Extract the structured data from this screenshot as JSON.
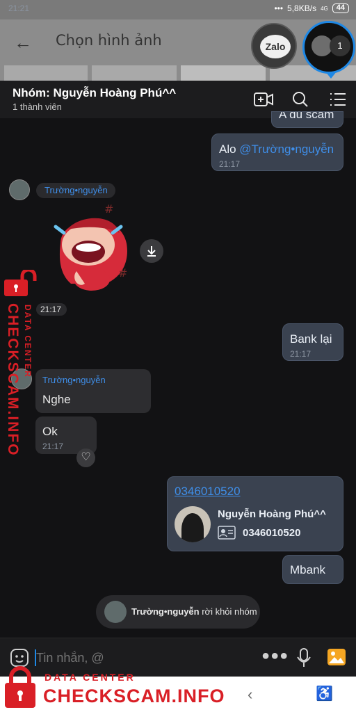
{
  "status_bar": {
    "time": "21:21",
    "speed": "5,8KB/s",
    "network": "4G",
    "battery": "44"
  },
  "picker": {
    "back_icon": "arrow-left-icon",
    "title": "Chọn hình ảnh"
  },
  "floating": {
    "zalo_label": "Zalo",
    "chat_badge": "1"
  },
  "header": {
    "title": "Nhóm: Nguyễn Hoàng Phú^^",
    "subtitle": "1 thành viên",
    "icons": [
      "video-call-icon",
      "search-icon",
      "menu-list-icon"
    ]
  },
  "messages": {
    "partial_top": "A đủ scam",
    "alo": {
      "text": "Alo ",
      "mention": "@Trường•nguyễn",
      "time": "21:17"
    },
    "sender1": "Trường•nguyễn",
    "sticker_time": "21:17",
    "bank": {
      "text": "Bank lại",
      "time": "21:17"
    },
    "sender2": "Trường•nguyễn",
    "nghe": "Nghe",
    "ok": {
      "text": "Ok",
      "time": "21:17"
    },
    "contact": {
      "number_link": "0346010520",
      "name": "Nguyễn Hoàng Phú^^",
      "phone": "0346010520"
    },
    "mbank": "Mbank",
    "leave_notice": {
      "name": "Trường•nguyễn",
      "text": " rời khỏi nhóm"
    }
  },
  "composer": {
    "placeholder": "Tin nhắn, @",
    "icons": [
      "sticker-icon",
      "more-icon",
      "mic-icon",
      "image-icon"
    ]
  },
  "watermark": {
    "side_top": "DATA CENTER",
    "side_main": "CHECKSCAM.INFO",
    "bottom_top": "DATA CENTER",
    "bottom_main": "CHECKSCAM.INFO"
  },
  "colors": {
    "accent": "#1e88e5",
    "mention": "#3f8ee8",
    "watermark": "#d91f26"
  }
}
